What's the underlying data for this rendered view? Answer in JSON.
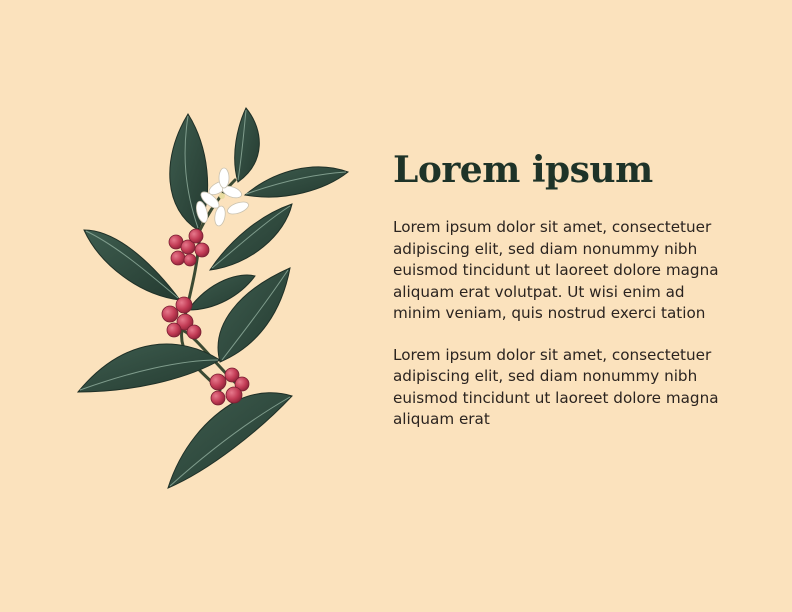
{
  "illustration": {
    "icon": "coffee-branch-illustration",
    "leaf_color": "#2f4a3e",
    "berry_color": "#c23b55",
    "flower_color": "#ffffff"
  },
  "heading": "Lorem ipsum",
  "paragraphs": [
    "Lorem ipsum dolor sit amet, consectetuer adipiscing elit, sed diam nonummy nibh euismod tincidunt ut laoreet dolore magna aliquam erat volutpat. Ut wisi enim ad minim veniam, quis nostrud exerci tation",
    "Lorem ipsum dolor sit amet, consectetuer adipiscing elit, sed diam nonummy nibh euismod tincidunt ut laoreet dolore magna aliquam erat"
  ],
  "colors": {
    "background": "#fbe2bd",
    "heading": "#1e3328",
    "body_text": "#2b2420"
  }
}
